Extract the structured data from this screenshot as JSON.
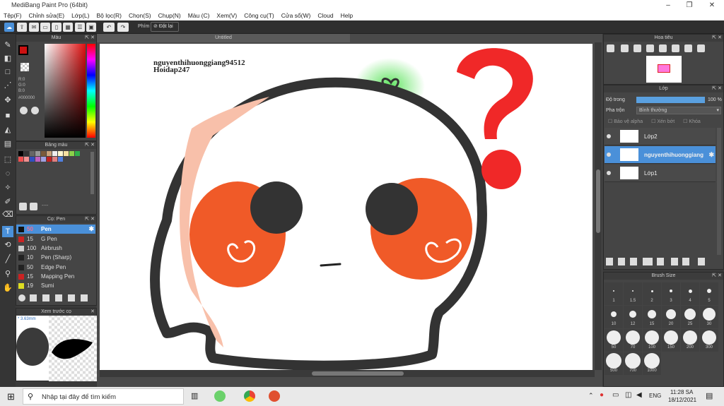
{
  "app": {
    "title": "MediBang Paint Pro (64bit)"
  },
  "menu": [
    "Tệp(F)",
    "Chỉnh sửa(E)",
    "Lớp(L)",
    "Bộ lọc(R)",
    "Chọn(S)",
    "Chụp(N)",
    "Màu (C)",
    "Xem(V)",
    "Công cụ(T)",
    "Cửa sổ(W)",
    "Cloud",
    "Help"
  ],
  "toolbar": {
    "shortcut_label": "Phím",
    "reset_label": "Đặt lại"
  },
  "color_panel": {
    "title": "Màu",
    "r": "R:0",
    "g": "G:0",
    "b": "B:0",
    "hex": "#000000",
    "fg": "#cc1111"
  },
  "palette_panel": {
    "title": "Bảng màu",
    "footer": "----"
  },
  "brush_panel": {
    "title": "Cọ: Pen",
    "items": [
      {
        "size": "50",
        "name": "Pen",
        "color": "#111111"
      },
      {
        "size": "15",
        "name": "G Pen",
        "color": "#cc2222"
      },
      {
        "size": "100",
        "name": "Airbrush",
        "color": "#cccccc"
      },
      {
        "size": "10",
        "name": "Pen (Sharp)",
        "color": "#222222"
      },
      {
        "size": "50",
        "name": "Edge Pen",
        "color": "#222222"
      },
      {
        "size": "15",
        "name": "Mapping Pen",
        "color": "#cc2222"
      },
      {
        "size": "19",
        "name": "Sumi",
        "color": "#dddd22"
      }
    ]
  },
  "preview_panel": {
    "title": "Xem trước cọ",
    "size": "* 3.63mm"
  },
  "document": {
    "tab": "Untitled",
    "line1": "nguyenthihuonggiang94512",
    "line2": "Hoidap247"
  },
  "navigator": {
    "title": "Hoa tiêu"
  },
  "layer_panel": {
    "title": "Lớp",
    "opacity_label": "Độ trong",
    "opacity_value": "100 %",
    "blend_label": "Pha trộn",
    "blend_value": "Bình thường",
    "protect_alpha": "Bảo vệ alpha",
    "clip": "Xén bớt",
    "lock": "Khóa",
    "layers": [
      {
        "name": "Lớp2"
      },
      {
        "name": "nguyenthihuonggiang"
      },
      {
        "name": "Lớp1"
      }
    ]
  },
  "brushsize_panel": {
    "title": "Brush Size",
    "sizes": [
      "1",
      "1.5",
      "2",
      "3",
      "4",
      "5",
      "10",
      "12",
      "15",
      "20",
      "25",
      "30",
      "50",
      "70",
      "100",
      "150",
      "200",
      "300",
      "500",
      "700",
      "1000"
    ]
  },
  "taskbar": {
    "search": "Nhập tại đây để tìm kiếm",
    "lang": "ENG",
    "time": "11:28 SA",
    "date": "18/12/2021"
  }
}
